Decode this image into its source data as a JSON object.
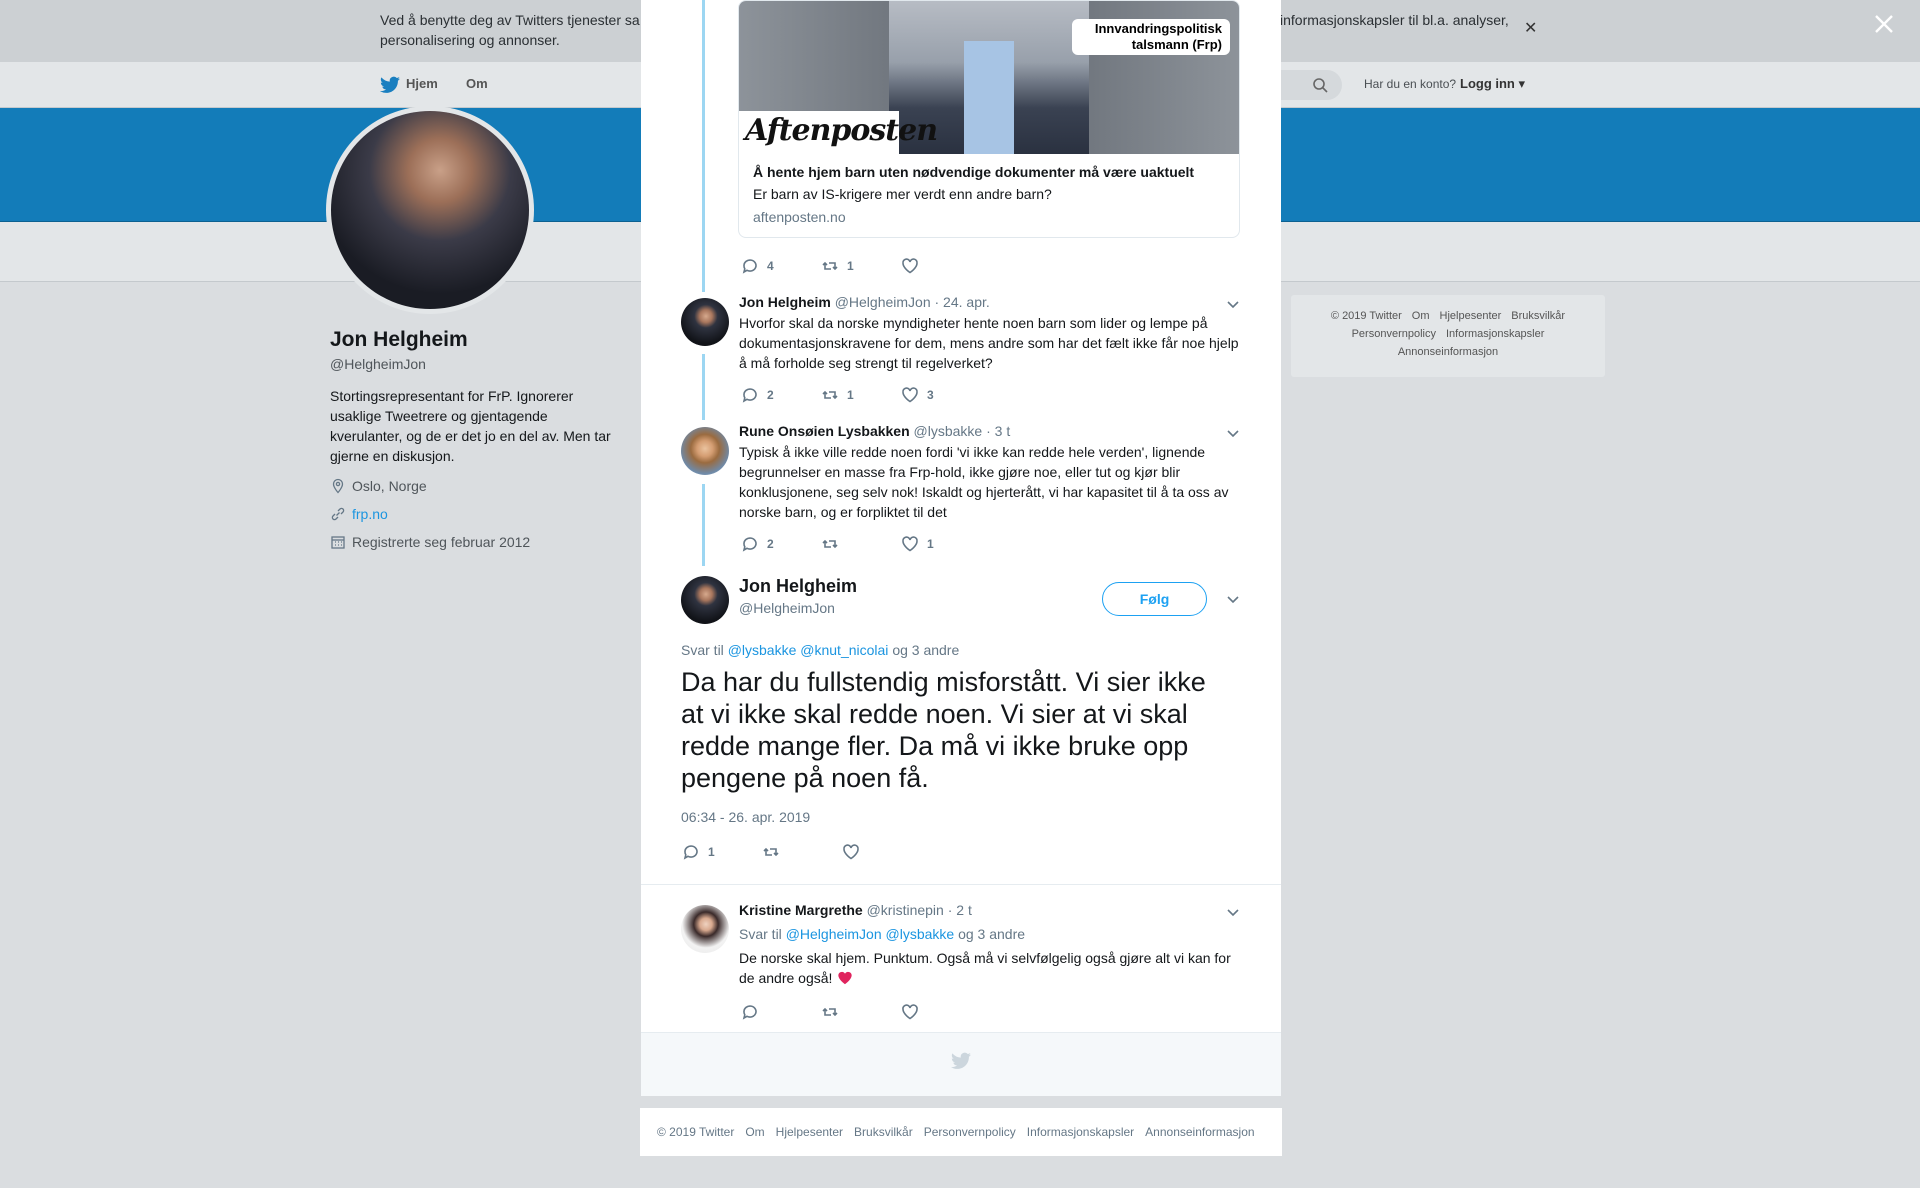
{
  "cookie": {
    "text_left": "Ved å benytte deg av Twitters tjenester sa",
    "text_left_2": "personalisering og annonser.",
    "text_right": "informasjonskapsler til bl.a. analyser,"
  },
  "nav": {
    "home": "Hjem",
    "about": "Om",
    "login_question": "Har du en konto?",
    "login": "Logg inn"
  },
  "profile": {
    "name": "Jon Helgheim",
    "handle": "@HelgheimJon",
    "bio": "Stortingsrepresentant for FrP. Ignorerer usaklige Tweetrere og gjentagende kverulanter, og de er det jo en del av. Men tar gjerne en diskusjon.",
    "location": "Oslo, Norge",
    "website": "frp.no",
    "joined": "Registrerte seg februar 2012"
  },
  "side_footer": {
    "items": [
      "© 2019 Twitter",
      "Om",
      "Hjelpesenter",
      "Bruksvilkår",
      "Personvernpolicy",
      "Informasjonskapsler",
      "Annonseinformasjon"
    ]
  },
  "card": {
    "tag_line1": "Innvandringspolitisk",
    "tag_line2": "talsmann (Frp)",
    "logo": "Aftenposten",
    "title": "Å hente hjem barn uten nødvendige dokumenter må være uaktuelt",
    "description": "Er barn av IS-krigere mer verdt enn andre barn?",
    "domain": "aftenposten.no",
    "replies": "4",
    "retweets": "1",
    "likes": ""
  },
  "tweets": [
    {
      "name": "Jon Helgheim",
      "handle": "@HelgheimJon",
      "time": "· 24. apr.",
      "text": "Hvorfor skal da norske myndigheter hente noen barn som lider og lempe på dokumentasjonskravene for dem, mens andre som har det fælt ikke får noe hjelp å må forholde seg strengt til regelverket?",
      "replies": "2",
      "retweets": "1",
      "likes": "3"
    },
    {
      "name": "Rune Onsøien Lysbakken",
      "handle": "@lysbakke",
      "time": "· 3 t",
      "text": "Typisk å ikke ville redde noen fordi 'vi ikke kan redde hele verden', lignende begrunnelser en masse fra Frp-hold, ikke gjøre noe, eller tut og kjør blir konklusjonene, seg selv nok! Iskaldt og hjerterått, vi har kapasitet til å ta oss av norske barn, og er forpliktet til det",
      "replies": "2",
      "retweets": "",
      "likes": "1"
    }
  ],
  "main_tweet": {
    "name": "Jon Helgheim",
    "handle": "@HelgheimJon",
    "follow": "Følg",
    "reply_to_label": "Svar til",
    "reply_to_1": "@lysbakke",
    "reply_to_2": "@knut_nicolai",
    "reply_to_rest": "og 3 andre",
    "text": "Da har du fullstendig misforstått. Vi sier ikke at vi ikke skal redde noen. Vi sier at vi skal redde mange fler. Da må vi ikke bruke opp pengene på noen få.",
    "timestamp": "06:34 - 26. apr. 2019",
    "replies": "1",
    "retweets": "",
    "likes": ""
  },
  "reply": {
    "name": "Kristine Margrethe",
    "handle": "@kristinepin",
    "time": "· 2 t",
    "reply_to_label": "Svar til",
    "reply_to_1": "@HelgheimJon",
    "reply_to_2": "@lysbakke",
    "reply_to_rest": "og 3 andre",
    "text": "De norske skal hjem. Punktum. Også må vi selvfølgelig også gjøre alt vi kan for de andre også!",
    "replies": "",
    "retweets": "",
    "likes": ""
  },
  "bottom_footer": {
    "items": [
      "© 2019 Twitter",
      "Om",
      "Hjelpesenter",
      "Bruksvilkår",
      "Personvernpolicy",
      "Informasjonskapsler",
      "Annonseinformasjon"
    ]
  },
  "colors": {
    "accent": "#1da1f2",
    "banner": "#137cb9",
    "thread": "#9cd6f2",
    "heart": "#e0245e"
  }
}
